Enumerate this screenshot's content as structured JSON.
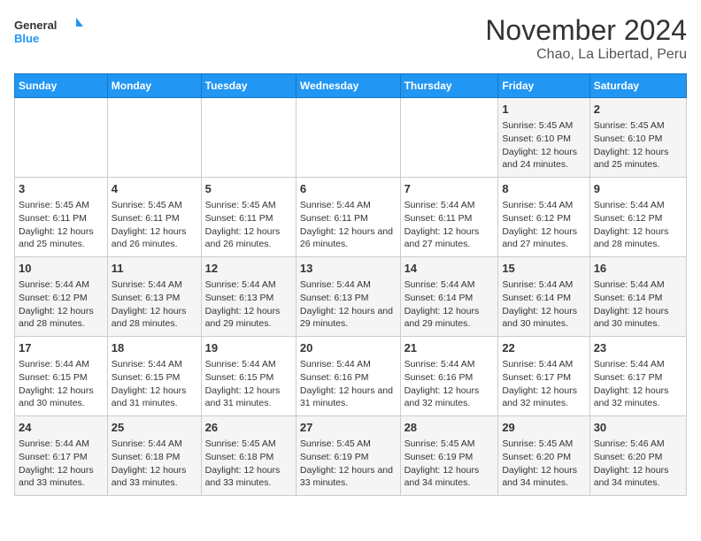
{
  "logo": {
    "line1": "General",
    "line2": "Blue"
  },
  "title": "November 2024",
  "subtitle": "Chao, La Libertad, Peru",
  "weekdays": [
    "Sunday",
    "Monday",
    "Tuesday",
    "Wednesday",
    "Thursday",
    "Friday",
    "Saturday"
  ],
  "weeks": [
    [
      {
        "day": "",
        "info": ""
      },
      {
        "day": "",
        "info": ""
      },
      {
        "day": "",
        "info": ""
      },
      {
        "day": "",
        "info": ""
      },
      {
        "day": "",
        "info": ""
      },
      {
        "day": "1",
        "info": "Sunrise: 5:45 AM\nSunset: 6:10 PM\nDaylight: 12 hours and 24 minutes."
      },
      {
        "day": "2",
        "info": "Sunrise: 5:45 AM\nSunset: 6:10 PM\nDaylight: 12 hours and 25 minutes."
      }
    ],
    [
      {
        "day": "3",
        "info": "Sunrise: 5:45 AM\nSunset: 6:11 PM\nDaylight: 12 hours and 25 minutes."
      },
      {
        "day": "4",
        "info": "Sunrise: 5:45 AM\nSunset: 6:11 PM\nDaylight: 12 hours and 26 minutes."
      },
      {
        "day": "5",
        "info": "Sunrise: 5:45 AM\nSunset: 6:11 PM\nDaylight: 12 hours and 26 minutes."
      },
      {
        "day": "6",
        "info": "Sunrise: 5:44 AM\nSunset: 6:11 PM\nDaylight: 12 hours and 26 minutes."
      },
      {
        "day": "7",
        "info": "Sunrise: 5:44 AM\nSunset: 6:11 PM\nDaylight: 12 hours and 27 minutes."
      },
      {
        "day": "8",
        "info": "Sunrise: 5:44 AM\nSunset: 6:12 PM\nDaylight: 12 hours and 27 minutes."
      },
      {
        "day": "9",
        "info": "Sunrise: 5:44 AM\nSunset: 6:12 PM\nDaylight: 12 hours and 28 minutes."
      }
    ],
    [
      {
        "day": "10",
        "info": "Sunrise: 5:44 AM\nSunset: 6:12 PM\nDaylight: 12 hours and 28 minutes."
      },
      {
        "day": "11",
        "info": "Sunrise: 5:44 AM\nSunset: 6:13 PM\nDaylight: 12 hours and 28 minutes."
      },
      {
        "day": "12",
        "info": "Sunrise: 5:44 AM\nSunset: 6:13 PM\nDaylight: 12 hours and 29 minutes."
      },
      {
        "day": "13",
        "info": "Sunrise: 5:44 AM\nSunset: 6:13 PM\nDaylight: 12 hours and 29 minutes."
      },
      {
        "day": "14",
        "info": "Sunrise: 5:44 AM\nSunset: 6:14 PM\nDaylight: 12 hours and 29 minutes."
      },
      {
        "day": "15",
        "info": "Sunrise: 5:44 AM\nSunset: 6:14 PM\nDaylight: 12 hours and 30 minutes."
      },
      {
        "day": "16",
        "info": "Sunrise: 5:44 AM\nSunset: 6:14 PM\nDaylight: 12 hours and 30 minutes."
      }
    ],
    [
      {
        "day": "17",
        "info": "Sunrise: 5:44 AM\nSunset: 6:15 PM\nDaylight: 12 hours and 30 minutes."
      },
      {
        "day": "18",
        "info": "Sunrise: 5:44 AM\nSunset: 6:15 PM\nDaylight: 12 hours and 31 minutes."
      },
      {
        "day": "19",
        "info": "Sunrise: 5:44 AM\nSunset: 6:15 PM\nDaylight: 12 hours and 31 minutes."
      },
      {
        "day": "20",
        "info": "Sunrise: 5:44 AM\nSunset: 6:16 PM\nDaylight: 12 hours and 31 minutes."
      },
      {
        "day": "21",
        "info": "Sunrise: 5:44 AM\nSunset: 6:16 PM\nDaylight: 12 hours and 32 minutes."
      },
      {
        "day": "22",
        "info": "Sunrise: 5:44 AM\nSunset: 6:17 PM\nDaylight: 12 hours and 32 minutes."
      },
      {
        "day": "23",
        "info": "Sunrise: 5:44 AM\nSunset: 6:17 PM\nDaylight: 12 hours and 32 minutes."
      }
    ],
    [
      {
        "day": "24",
        "info": "Sunrise: 5:44 AM\nSunset: 6:17 PM\nDaylight: 12 hours and 33 minutes."
      },
      {
        "day": "25",
        "info": "Sunrise: 5:44 AM\nSunset: 6:18 PM\nDaylight: 12 hours and 33 minutes."
      },
      {
        "day": "26",
        "info": "Sunrise: 5:45 AM\nSunset: 6:18 PM\nDaylight: 12 hours and 33 minutes."
      },
      {
        "day": "27",
        "info": "Sunrise: 5:45 AM\nSunset: 6:19 PM\nDaylight: 12 hours and 33 minutes."
      },
      {
        "day": "28",
        "info": "Sunrise: 5:45 AM\nSunset: 6:19 PM\nDaylight: 12 hours and 34 minutes."
      },
      {
        "day": "29",
        "info": "Sunrise: 5:45 AM\nSunset: 6:20 PM\nDaylight: 12 hours and 34 minutes."
      },
      {
        "day": "30",
        "info": "Sunrise: 5:46 AM\nSunset: 6:20 PM\nDaylight: 12 hours and 34 minutes."
      }
    ]
  ]
}
